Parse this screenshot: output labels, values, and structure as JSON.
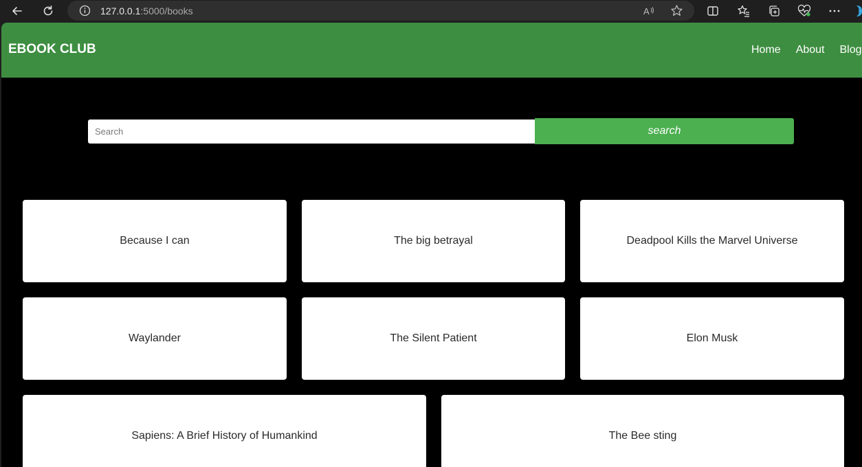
{
  "browser": {
    "url_host": "127.0.0.1",
    "url_path": ":5000/books"
  },
  "navbar": {
    "brand": "EBOOK CLUB",
    "links": [
      {
        "label": "Home"
      },
      {
        "label": "About"
      },
      {
        "label": "Blog"
      }
    ]
  },
  "search": {
    "placeholder": "Search",
    "button_label": "search"
  },
  "books": [
    {
      "title": "Because I can"
    },
    {
      "title": "The big betrayal"
    },
    {
      "title": "Deadpool Kills the Marvel Universe"
    },
    {
      "title": "Waylander"
    },
    {
      "title": "The Silent Patient"
    },
    {
      "title": "Elon Musk"
    },
    {
      "title": "Sapiens: A Brief History of Humankind"
    },
    {
      "title": "The Bee sting"
    }
  ],
  "colors": {
    "navbar": "#3e8e41",
    "search_button": "#4caf50",
    "page_background": "#000000"
  }
}
